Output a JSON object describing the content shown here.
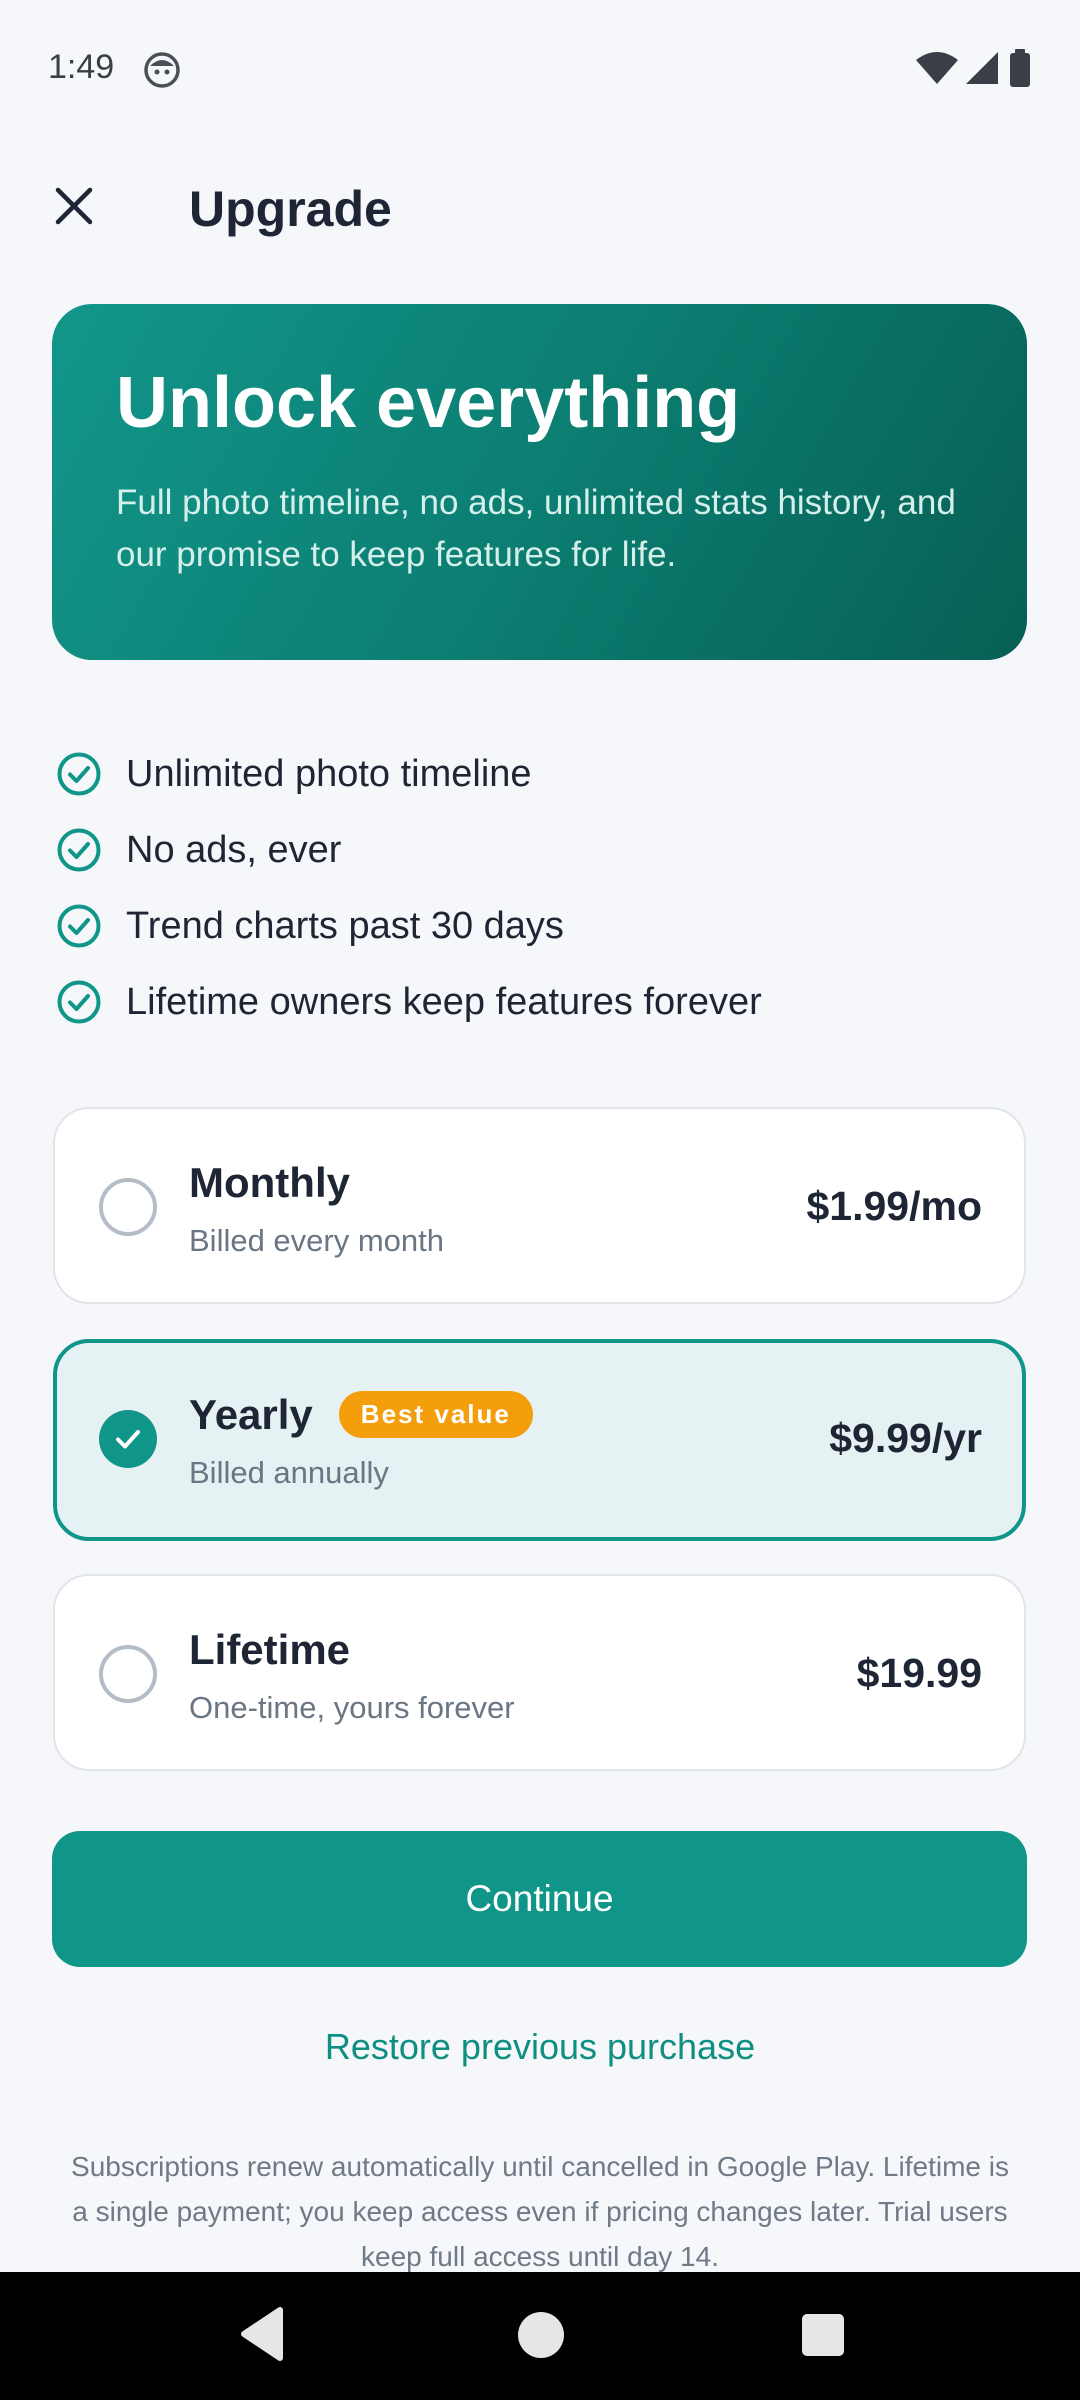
{
  "status_bar": {
    "time": "1:49",
    "icons": [
      "face-icon",
      "wifi-icon",
      "signal-icon",
      "battery-icon"
    ]
  },
  "header": {
    "close_icon": "close-icon",
    "title": "Upgrade"
  },
  "hero": {
    "title": "Unlock everything",
    "description": "Full photo timeline, no ads, unlimited stats history, and our promise to keep features for life."
  },
  "features": [
    {
      "label": "Unlimited photo timeline",
      "icon": "check-circle-icon"
    },
    {
      "label": "No ads, ever",
      "icon": "check-circle-icon"
    },
    {
      "label": "Trend charts past 30 days",
      "icon": "check-circle-icon"
    },
    {
      "label": "Lifetime owners keep features forever",
      "icon": "check-circle-icon"
    }
  ],
  "plans": [
    {
      "name": "Monthly",
      "subtitle": "Billed every month",
      "price": "$1.99/mo",
      "selected": false
    },
    {
      "name": "Yearly",
      "subtitle": "Billed annually",
      "price": "$9.99/yr",
      "badge": "Best value",
      "selected": true
    },
    {
      "name": "Lifetime",
      "subtitle": "One-time, yours forever",
      "price": "$19.99",
      "selected": false
    }
  ],
  "actions": {
    "continue_label": "Continue",
    "restore_label": "Restore previous purchase"
  },
  "footnote": "Subscriptions renew automatically until cancelled in Google Play. Lifetime is a single payment; you keep access even if pricing changes later. Trial users keep full access until day 14.",
  "colors": {
    "accent": "#0f9688",
    "badge": "#f59e0b",
    "background": "#f5f7fa",
    "hero_start": "#12968a",
    "hero_end": "#075f55"
  }
}
